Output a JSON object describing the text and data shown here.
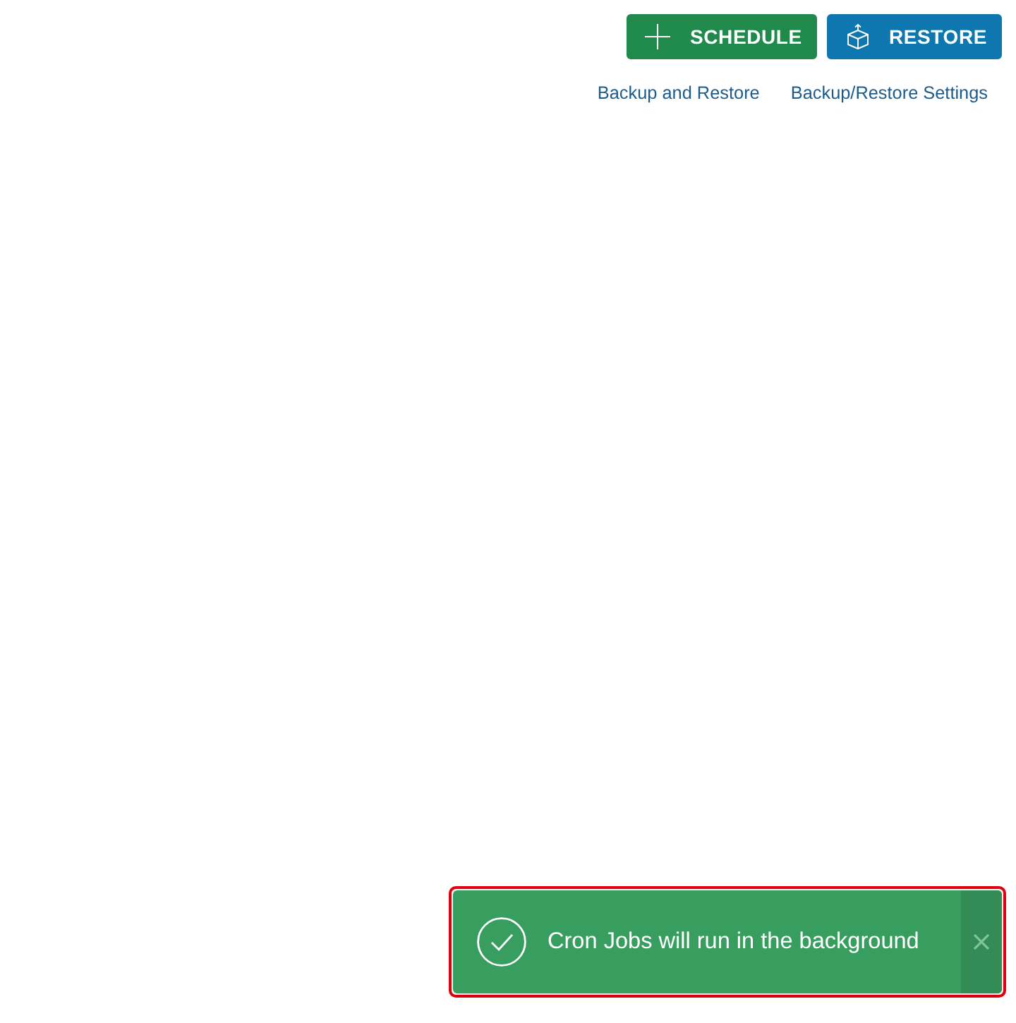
{
  "actions": [
    {
      "kind": "add",
      "label": "SCHEDULE"
    },
    {
      "kind": "restore",
      "label": "RESTORE"
    }
  ],
  "links": [
    "Backup and Restore",
    "Backup/Restore Settings"
  ],
  "toast": {
    "kind": "success",
    "message": "Cron Jobs will run in the background",
    "highlighted": true
  }
}
